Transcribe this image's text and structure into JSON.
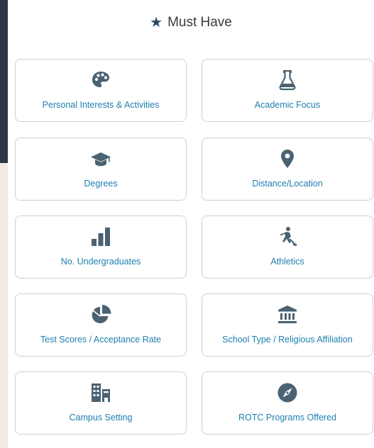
{
  "header": {
    "title": "Must Have",
    "icon": "star-icon"
  },
  "colors": {
    "accent": "#1e7fb0",
    "icon": "#4a6272",
    "dark_bg": "#2c3648",
    "beige_bg": "#f3e9e2"
  },
  "options": [
    {
      "label": "Personal Interests & Activities",
      "icon": "palette-icon"
    },
    {
      "label": "Academic Focus",
      "icon": "flask-icon"
    },
    {
      "label": "Degrees",
      "icon": "graduation-cap-icon"
    },
    {
      "label": "Distance/Location",
      "icon": "map-pin-icon"
    },
    {
      "label": "No. Undergraduates",
      "icon": "bar-chart-icon"
    },
    {
      "label": "Athletics",
      "icon": "hockey-player-icon"
    },
    {
      "label": "Test Scores / Acceptance Rate",
      "icon": "pie-chart-icon"
    },
    {
      "label": "School Type / Religious Affiliation",
      "icon": "bank-icon"
    },
    {
      "label": "Campus Setting",
      "icon": "buildings-icon"
    },
    {
      "label": "ROTC Programs Offered",
      "icon": "compass-icon"
    }
  ]
}
